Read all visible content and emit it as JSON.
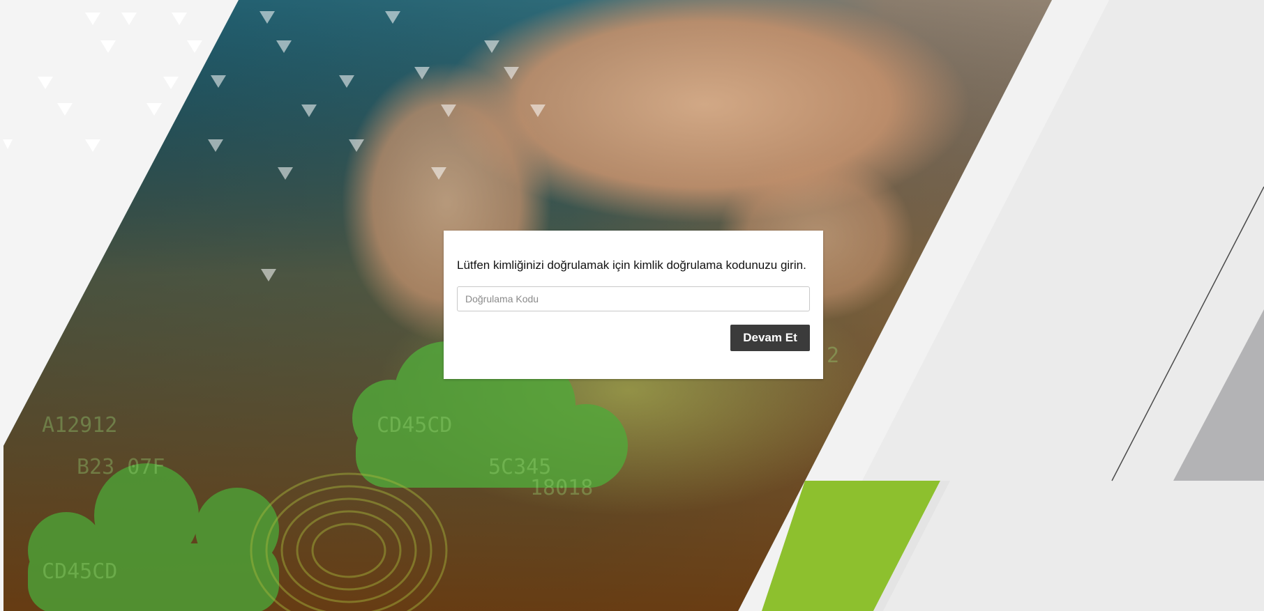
{
  "verification": {
    "message": "Lütfen kimliğinizi doğrulamak için kimlik doğrulama kodunuzu girin.",
    "code_placeholder": "Doğrulama Kodu",
    "code_value": "",
    "continue_label": "Devam Et"
  },
  "colors": {
    "page_background": "#ebebeb",
    "accent_green": "#8dc02e",
    "accent_gray": "#b3b3b5",
    "button_background": "#3b3b3b",
    "button_text": "#ffffff"
  }
}
